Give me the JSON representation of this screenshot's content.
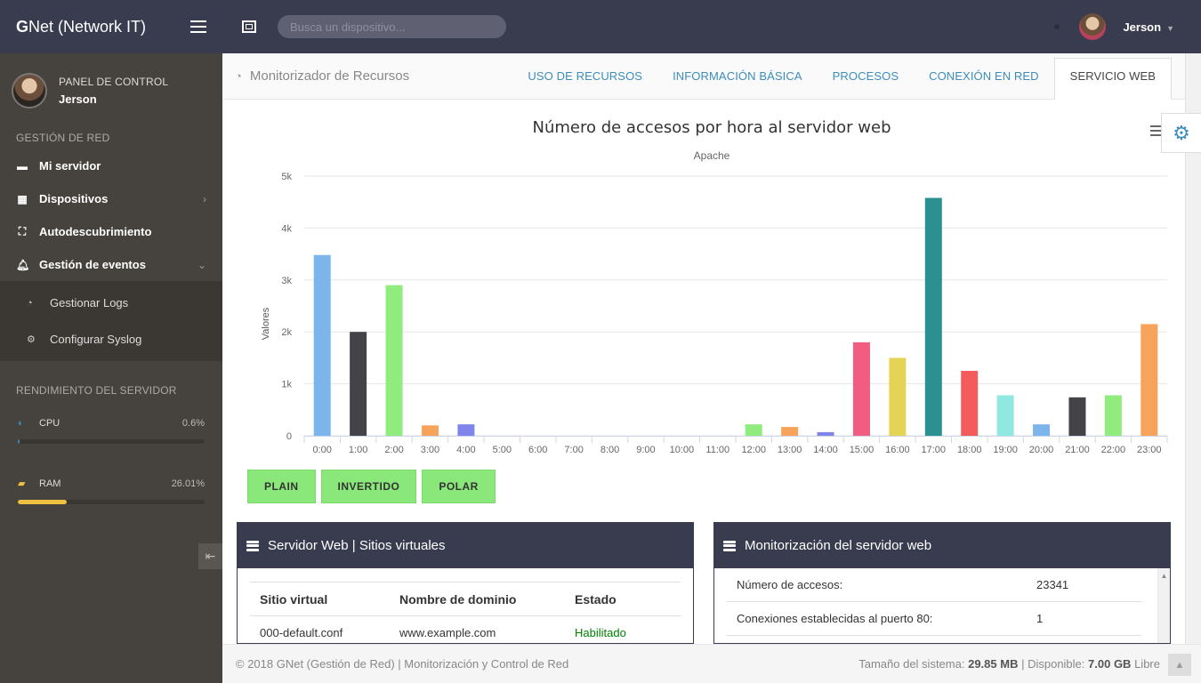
{
  "app": {
    "brand_bold": "G",
    "brand_rest": "Net (Network IT)"
  },
  "sidebar": {
    "panel_title": "PANEL DE CONTROL",
    "user_name": "Jerson",
    "section_network": "GESTIÓN DE RED",
    "items": [
      {
        "label": "Mi servidor",
        "icon": "server-icon"
      },
      {
        "label": "Dispositivos",
        "icon": "grid-icon"
      },
      {
        "label": "Autodescubrimiento",
        "icon": "sitemap-icon"
      },
      {
        "label": "Gestión de eventos",
        "icon": "bell-icon"
      }
    ],
    "subitems": [
      {
        "label": "Gestionar Logs",
        "icon": "dashboard-icon"
      },
      {
        "label": "Configurar Syslog",
        "icon": "cogs-icon"
      }
    ],
    "section_perf": "RENDIMIENTO DEL SERVIDOR",
    "cpu": {
      "label": "CPU",
      "value": "0.6%",
      "fraction": 0.006,
      "color": "#3c8dbc"
    },
    "ram": {
      "label": "RAM",
      "value": "26.01%",
      "fraction": 0.2601,
      "color": "#f0c040"
    }
  },
  "topbar": {
    "search_placeholder": "Busca un dispositivo...",
    "user": "Jerson"
  },
  "header": {
    "page_title": "Monitorizador de Recursos",
    "tabs": [
      "USO DE RECURSOS",
      "INFORMACIÓN BÁSICA",
      "PROCESOS",
      "CONEXIÓN EN RED",
      "SERVICIO WEB"
    ],
    "active_tab": 4
  },
  "chart_data": {
    "type": "bar",
    "title": "Número de accesos por hora al servidor web",
    "subtitle": "Apache",
    "ylabel": "Valores",
    "ylim": [
      0,
      5000
    ],
    "y_ticks": [
      "0",
      "1k",
      "2k",
      "3k",
      "4k",
      "5k"
    ],
    "grid": true,
    "categories": [
      "0:00",
      "1:00",
      "2:00",
      "3:00",
      "4:00",
      "5:00",
      "6:00",
      "7:00",
      "8:00",
      "9:00",
      "10:00",
      "11:00",
      "12:00",
      "13:00",
      "14:00",
      "15:00",
      "16:00",
      "17:00",
      "18:00",
      "19:00",
      "20:00",
      "21:00",
      "22:00",
      "23:00"
    ],
    "values": [
      3480,
      2000,
      2900,
      200,
      220,
      0,
      0,
      0,
      0,
      0,
      0,
      0,
      220,
      170,
      70,
      1800,
      1500,
      4580,
      1250,
      780,
      220,
      740,
      780,
      2150
    ],
    "colors": [
      "#7cb5ec",
      "#434348",
      "#90ed7d",
      "#f7a35c",
      "#8085e9",
      "#f15c80",
      "#e4d354",
      "#2b908f",
      "#f45b5b",
      "#91e8e1",
      "#7cb5ec",
      "#434348",
      "#90ed7d",
      "#f7a35c",
      "#8085e9",
      "#f15c80",
      "#e4d354",
      "#2b908f",
      "#f45b5b",
      "#91e8e1",
      "#7cb5ec",
      "#434348",
      "#90ed7d",
      "#f7a35c"
    ]
  },
  "chart_buttons": [
    "PLAIN",
    "INVERTIDO",
    "POLAR"
  ],
  "vhosts_panel": {
    "title": "Servidor Web | Sitios virtuales",
    "headers": [
      "Sitio virtual",
      "Nombre de dominio",
      "Estado"
    ],
    "rows": [
      [
        "000-default.conf",
        "www.example.com",
        "Habilitado"
      ]
    ]
  },
  "monitor_panel": {
    "title": "Monitorización del servidor web",
    "rows": [
      [
        "Número de accesos:",
        "23341"
      ],
      [
        "Conexiones establecidas al puerto 80:",
        "1"
      ]
    ]
  },
  "footer": {
    "left": "© 2018 GNet (Gestión de Red) | Monitorización y Control de Red",
    "size_label": "Tamaño del sistema:",
    "size_value": "29.85 MB",
    "avail_label": "Disponible:",
    "avail_value": "7.00 GB",
    "free_label": "Libre"
  }
}
